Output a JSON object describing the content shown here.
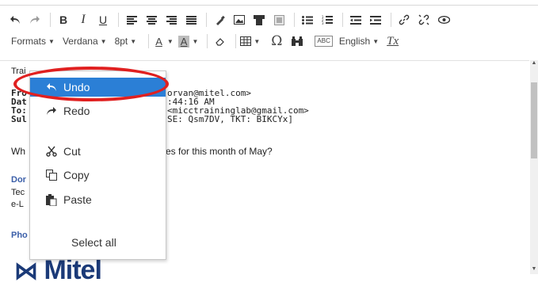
{
  "toolbar": {
    "row1": {
      "undo_icon": "undo-arrow",
      "redo_icon": "redo-arrow",
      "bold": "B",
      "italic": "I",
      "underline": "U"
    },
    "row2": {
      "formats": "Formats",
      "font": "Verdana",
      "size": "8pt",
      "font_color": "A",
      "bg_color": "A",
      "omega": "Ω",
      "spell": "ABC",
      "language": "English",
      "clear_format": "Tx"
    }
  },
  "document": {
    "partial_line": "Trai",
    "from_label": "Fro",
    "from_value": "orvan@mitel.com>",
    "date_label": "Dat",
    "date_value": ":44:16 AM",
    "to_label": "To:",
    "to_value": "<micctraininglab@gmail.com>",
    "subject_label": "Sul",
    "subject_value": "SE: Qsm7DV, TKT: BIKCYx]",
    "body_partial": "Wh",
    "body_rest": "es for this month of May?",
    "sig_name": "Dor",
    "sig_title": "Tec",
    "sig_dept": "e-L",
    "phone_label": "Pho",
    "logo": "Mitel"
  },
  "context_menu": {
    "items": [
      {
        "label": "Undo",
        "icon": "undo-icon",
        "selected": true
      },
      {
        "label": "Redo",
        "icon": "redo-icon",
        "selected": false
      },
      {
        "label": "Cut",
        "icon": "scissors-icon",
        "selected": false
      },
      {
        "label": "Copy",
        "icon": "copy-icon",
        "selected": false
      },
      {
        "label": "Paste",
        "icon": "paste-icon",
        "selected": false
      },
      {
        "label": "Select all",
        "icon": "",
        "selected": false
      }
    ]
  },
  "colors": {
    "menu_selected": "#2b7fd6",
    "annotation": "#e02020",
    "logo": "#1b3a78"
  }
}
